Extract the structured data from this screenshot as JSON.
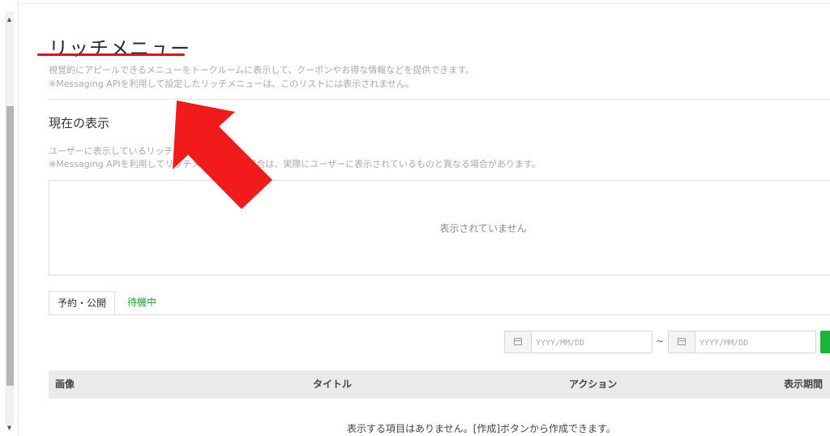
{
  "header": {
    "title": "リッチメニュー",
    "description_1": "視覚的にアピールできるメニューをトークルームに表示して、クーポンやお得な情報などを提供できます。",
    "description_2": "※Messaging APIを利用して設定したリッチメニューは、このリストには表示されません。"
  },
  "current": {
    "title": "現在の表示",
    "description_1": "ユーザーに表示しているリッチメニ",
    "description_2": "※Messaging APIを利用してリッチメ                    定している場合は、実際にユーザーに表示されているものと異なる場合があります。",
    "empty_text": "表示されていません"
  },
  "tabs": [
    {
      "label": "予約・公開",
      "active": true
    },
    {
      "label": "待機中",
      "active": false
    }
  ],
  "filter": {
    "start_placeholder": "YYYY/MM/DD",
    "end_placeholder": "YYYY/MM/DD",
    "separator": "~"
  },
  "table": {
    "columns": [
      "画像",
      "タイトル",
      "アクション",
      "表示期間"
    ],
    "empty_text": "表示する項目はありません。[作成]ボタンから作成できます。"
  },
  "colors": {
    "accent_green": "#19b43c",
    "underline_red": "#e0121c",
    "arrow_red": "#f21b1b"
  },
  "icons": {
    "calendar": "calendar-icon",
    "scroll_up": "chevron-up-icon",
    "scroll_down": "chevron-down-icon"
  }
}
